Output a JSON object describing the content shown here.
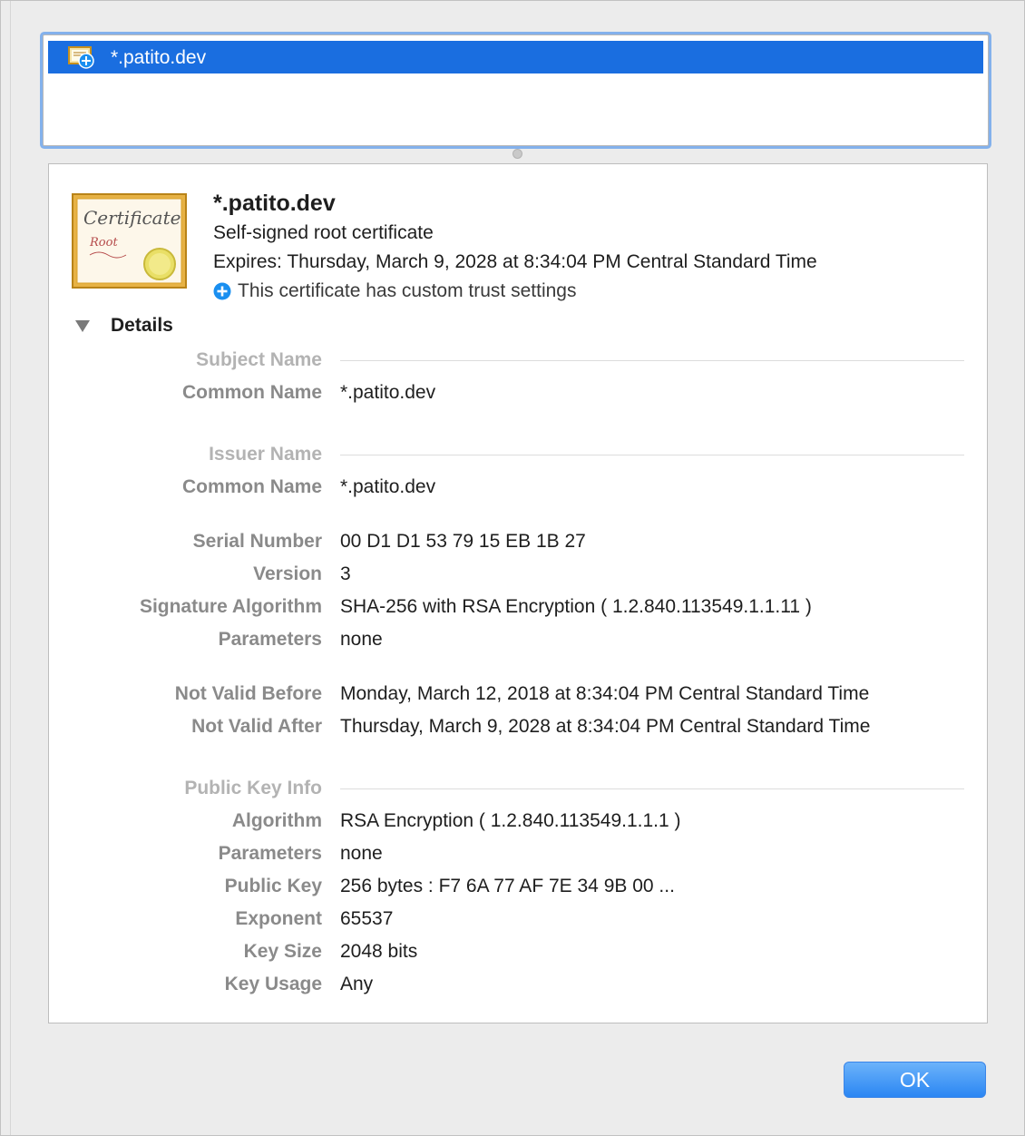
{
  "cert_list": {
    "items": [
      {
        "label": "*.patito.dev",
        "selected": true
      }
    ]
  },
  "certificate": {
    "icon_script": "Certificate",
    "icon_sub": "Root",
    "title": "*.patito.dev",
    "subtitle": "Self-signed root certificate",
    "expires": "Expires: Thursday, March 9, 2028 at 8:34:04 PM Central Standard Time",
    "trust": "This certificate has custom trust settings"
  },
  "details": {
    "toggle_label": "Details",
    "sections": {
      "subject_name": "Subject Name",
      "issuer_name": "Issuer Name",
      "public_key_info": "Public Key Info"
    },
    "fields": {
      "subject_common_name": {
        "label": "Common Name",
        "value": "*.patito.dev"
      },
      "issuer_common_name": {
        "label": "Common Name",
        "value": "*.patito.dev"
      },
      "serial_number": {
        "label": "Serial Number",
        "value": "00 D1 D1 53 79 15 EB 1B 27"
      },
      "version": {
        "label": "Version",
        "value": "3"
      },
      "signature_algorithm": {
        "label": "Signature Algorithm",
        "value": "SHA-256 with RSA Encryption ( 1.2.840.113549.1.1.11 )"
      },
      "sig_parameters": {
        "label": "Parameters",
        "value": "none"
      },
      "not_valid_before": {
        "label": "Not Valid Before",
        "value": "Monday, March 12, 2018 at 8:34:04 PM Central Standard Time"
      },
      "not_valid_after": {
        "label": "Not Valid After",
        "value": "Thursday, March 9, 2028 at 8:34:04 PM Central Standard Time"
      },
      "pk_algorithm": {
        "label": "Algorithm",
        "value": "RSA Encryption ( 1.2.840.113549.1.1.1 )"
      },
      "pk_parameters": {
        "label": "Parameters",
        "value": "none"
      },
      "public_key": {
        "label": "Public Key",
        "value": "256 bytes : F7 6A 77 AF 7E 34 9B 00 ..."
      },
      "exponent": {
        "label": "Exponent",
        "value": "65537"
      },
      "key_size": {
        "label": "Key Size",
        "value": "2048 bits"
      },
      "key_usage": {
        "label": "Key Usage",
        "value": "Any"
      }
    }
  },
  "footer": {
    "ok_label": "OK"
  },
  "colors": {
    "selection": "#1a6ee0",
    "focus_ring": "#83b1ec",
    "button_top": "#6cb3fa",
    "button_bottom": "#2a86f3",
    "plus_icon": "#1a8ff0",
    "certificate_frame": "#d9a12b"
  }
}
